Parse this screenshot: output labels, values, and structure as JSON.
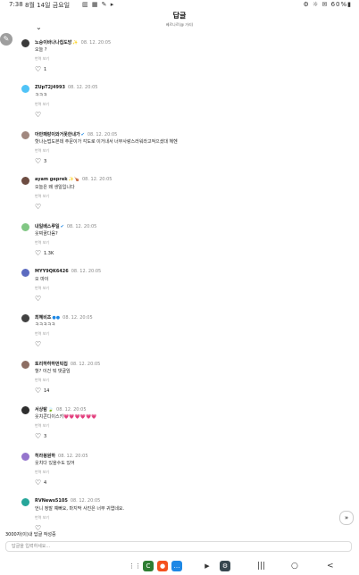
{
  "status_bar": {
    "time": "7:38",
    "date": "8월 14일 금요일",
    "icons": "▥ ▦ ✎ ▸",
    "right": "⚙ ☼ ✉ 60%▮"
  },
  "header": {
    "title": "답글",
    "subtitle": "베르나르(@ 거리)"
  },
  "comments": [
    {
      "name": "노숭이바나나칩도방",
      "badge": "✨",
      "time": "08. 12. 20:05",
      "text": "오늘 ?",
      "translate": "번역 보기",
      "likes": "1",
      "avatar_color": "#3a3a3a"
    },
    {
      "name": "ZUpT2J4993",
      "badge": "",
      "time": "08. 12. 20:05",
      "text": "ㅋㅋㅋ",
      "translate": "번역 보기",
      "likes": "",
      "avatar_color": "#4fc3f7"
    },
    {
      "name": "아만패랑이와거못한내가",
      "badge": "✔",
      "time": "08. 12. 20:05",
      "text": "핫나는법도본데 주문이가 각도로 이거내서 너무사랑스러워라고적으셨대 헤헨",
      "translate": "번역 보기",
      "likes": "3",
      "avatar_color": "#a1887f"
    },
    {
      "name": "ayam geprek",
      "badge": "✨🍗",
      "time": "08. 12. 20:05",
      "text": "오늘은 왜 생일입니다",
      "translate": "번역 보기",
      "likes": "",
      "avatar_color": "#6d4c41"
    },
    {
      "name": "내일배스루일",
      "badge": "✔",
      "time": "08. 12. 20:05",
      "text": "웃찌꿈다음?",
      "translate": "번역 보기",
      "likes": "1.3K",
      "avatar_color": "#81c784"
    },
    {
      "name": "MYY9QK6426",
      "badge": "",
      "time": "08. 12. 20:05",
      "text": "오 마이",
      "translate": "번역 보기",
      "likes": "",
      "avatar_color": "#5c6bc0"
    },
    {
      "name": "최혜비초",
      "badge": "●●",
      "time": "08. 12. 20:05",
      "text": "ㅋㅋㅋㅋㅋ",
      "translate": "번역 보기",
      "likes": "",
      "avatar_color": "#424242"
    },
    {
      "name": "토리하하하먼빅칩",
      "badge": "",
      "time": "08. 12. 20:05",
      "text": "헐? 이건 뭐 댓글임",
      "translate": "번역 보기",
      "likes": "14",
      "avatar_color": "#8d6e63"
    },
    {
      "name": "서상탐",
      "badge": "🍃",
      "time": "08. 12. 20:05",
      "text": "웃치콘디이스키💗💗💗💗💗💗",
      "translate": "번역 보기",
      "likes": "3",
      "avatar_color": "#2e2e2e"
    },
    {
      "name": "히라붕원하",
      "badge": "",
      "time": "08. 12. 20:05",
      "text": "웃치다 있을수도 있어",
      "translate": "번역 보기",
      "likes": "4",
      "avatar_color": "#9575cd"
    },
    {
      "name": "RVNews5105",
      "badge": "",
      "time": "08. 12. 20:05",
      "text": "언니 정말 예뻐요, 마지막 사진은 너무 귀엽네요.",
      "translate": "번역 보기",
      "likes": "",
      "avatar_color": "#26a69a"
    }
  ],
  "footer": {
    "notice": "3000자(이)내 답글 작성중",
    "reply_placeholder": "답글을 입력하세요..."
  },
  "nav": {
    "apps": [
      {
        "name": "grid",
        "glyph": "⋮⋮",
        "color": "#ffffff"
      },
      {
        "name": "green-app",
        "glyph": "C",
        "color": "#2e7d32"
      },
      {
        "name": "orange-app",
        "glyph": "●",
        "color": "#f4511e"
      },
      {
        "name": "chat-app",
        "glyph": "…",
        "color": "#1e88e5"
      },
      {
        "name": "play-app",
        "glyph": "▶",
        "color": "#ffffff"
      },
      {
        "name": "settings-app",
        "glyph": "⚙",
        "color": "#37474f"
      }
    ],
    "sys": [
      "|||",
      "○",
      "<"
    ]
  }
}
